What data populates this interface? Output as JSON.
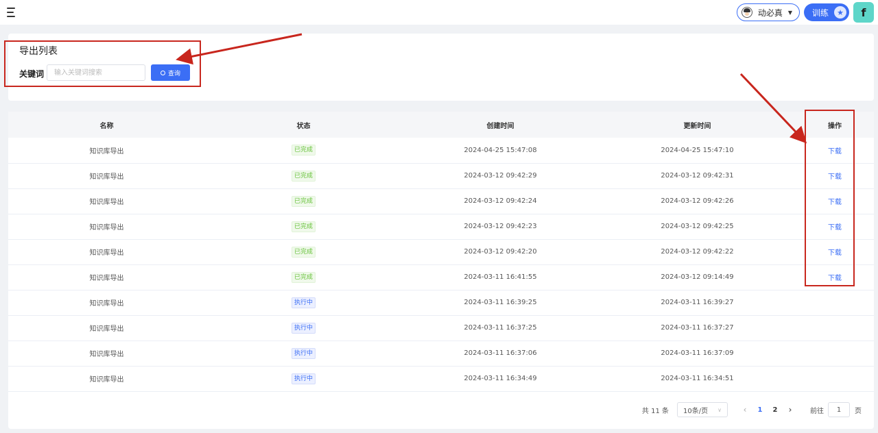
{
  "header": {
    "user_name": "动必真",
    "train_label": "训练",
    "star_glyph": "★",
    "logo_glyph": "f"
  },
  "search": {
    "title": "导出列表",
    "keyword_label": "关键词",
    "placeholder": "输入关键词搜索",
    "query_label": "查询"
  },
  "table": {
    "columns": [
      "名称",
      "状态",
      "创建时间",
      "更新时间",
      "操作"
    ],
    "rows": [
      {
        "name": "知识库导出",
        "status": "已完成",
        "status_type": "done",
        "created": "2024-04-25 15:47:08",
        "updated": "2024-04-25 15:47:10",
        "action": "下载"
      },
      {
        "name": "知识库导出",
        "status": "已完成",
        "status_type": "done",
        "created": "2024-03-12 09:42:29",
        "updated": "2024-03-12 09:42:31",
        "action": "下载"
      },
      {
        "name": "知识库导出",
        "status": "已完成",
        "status_type": "done",
        "created": "2024-03-12 09:42:24",
        "updated": "2024-03-12 09:42:26",
        "action": "下载"
      },
      {
        "name": "知识库导出",
        "status": "已完成",
        "status_type": "done",
        "created": "2024-03-12 09:42:23",
        "updated": "2024-03-12 09:42:25",
        "action": "下载"
      },
      {
        "name": "知识库导出",
        "status": "已完成",
        "status_type": "done",
        "created": "2024-03-12 09:42:20",
        "updated": "2024-03-12 09:42:22",
        "action": "下载"
      },
      {
        "name": "知识库导出",
        "status": "已完成",
        "status_type": "done",
        "created": "2024-03-11 16:41:55",
        "updated": "2024-03-12 09:14:49",
        "action": "下载"
      },
      {
        "name": "知识库导出",
        "status": "执行中",
        "status_type": "running",
        "created": "2024-03-11 16:39:25",
        "updated": "2024-03-11 16:39:27",
        "action": ""
      },
      {
        "name": "知识库导出",
        "status": "执行中",
        "status_type": "running",
        "created": "2024-03-11 16:37:25",
        "updated": "2024-03-11 16:37:27",
        "action": ""
      },
      {
        "name": "知识库导出",
        "status": "执行中",
        "status_type": "running",
        "created": "2024-03-11 16:37:06",
        "updated": "2024-03-11 16:37:09",
        "action": ""
      },
      {
        "name": "知识库导出",
        "status": "执行中",
        "status_type": "running",
        "created": "2024-03-11 16:34:49",
        "updated": "2024-03-11 16:34:51",
        "action": ""
      }
    ]
  },
  "pagination": {
    "total_text": "共 11 条",
    "page_size": "10条/页",
    "pages": [
      "1",
      "2"
    ],
    "current_page": "1",
    "goto_label": "前往",
    "goto_value": "1",
    "page_unit": "页"
  },
  "colors": {
    "accent": "#3b6ef5",
    "done_tag": "#67c23a",
    "annotation": "#c8261d"
  }
}
